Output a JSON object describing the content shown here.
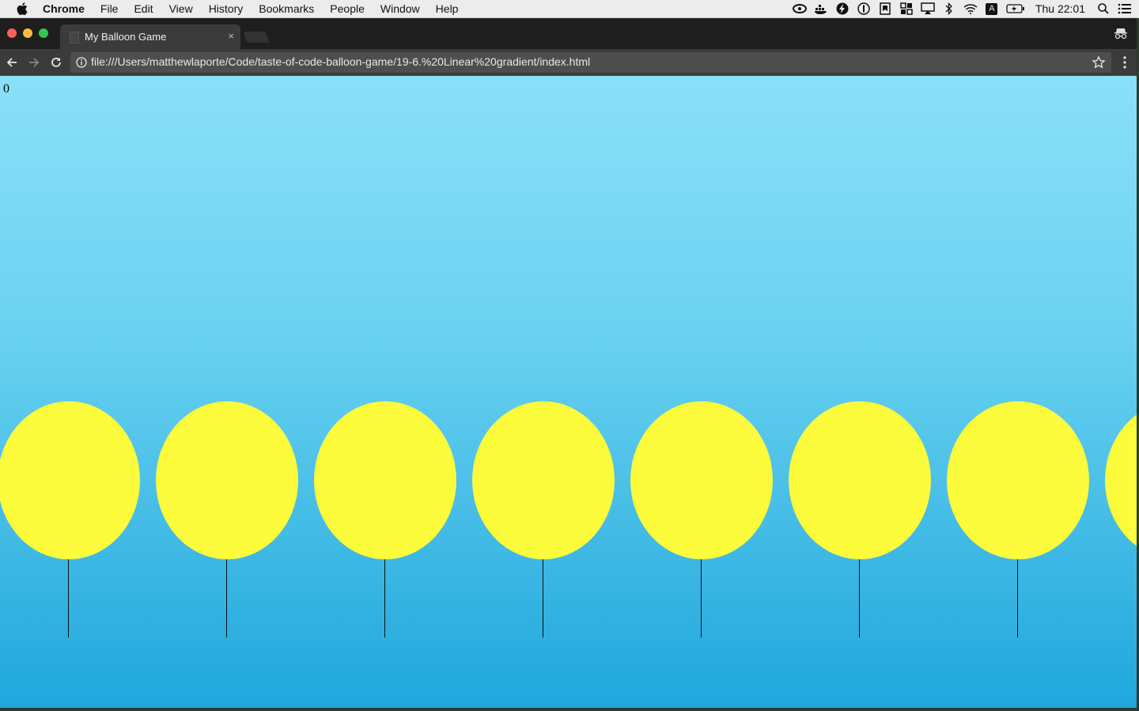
{
  "menubar": {
    "app": "Chrome",
    "items": [
      "File",
      "Edit",
      "View",
      "History",
      "Bookmarks",
      "People",
      "Window",
      "Help"
    ],
    "clock": "Thu 22:01",
    "input_source": "A"
  },
  "tab": {
    "title": "My Balloon Game",
    "close": "×"
  },
  "omnibox": {
    "url": "file:///Users/matthewlaporte/Code/taste-of-code-balloon-game/19-6.%20Linear%20gradient/index.html"
  },
  "game": {
    "score": "0",
    "balloon_count": 8,
    "balloon_color": "#fcfc3c",
    "sky_top_color": "#8ae0f9",
    "sky_bottom_color": "#1fa7dc"
  }
}
